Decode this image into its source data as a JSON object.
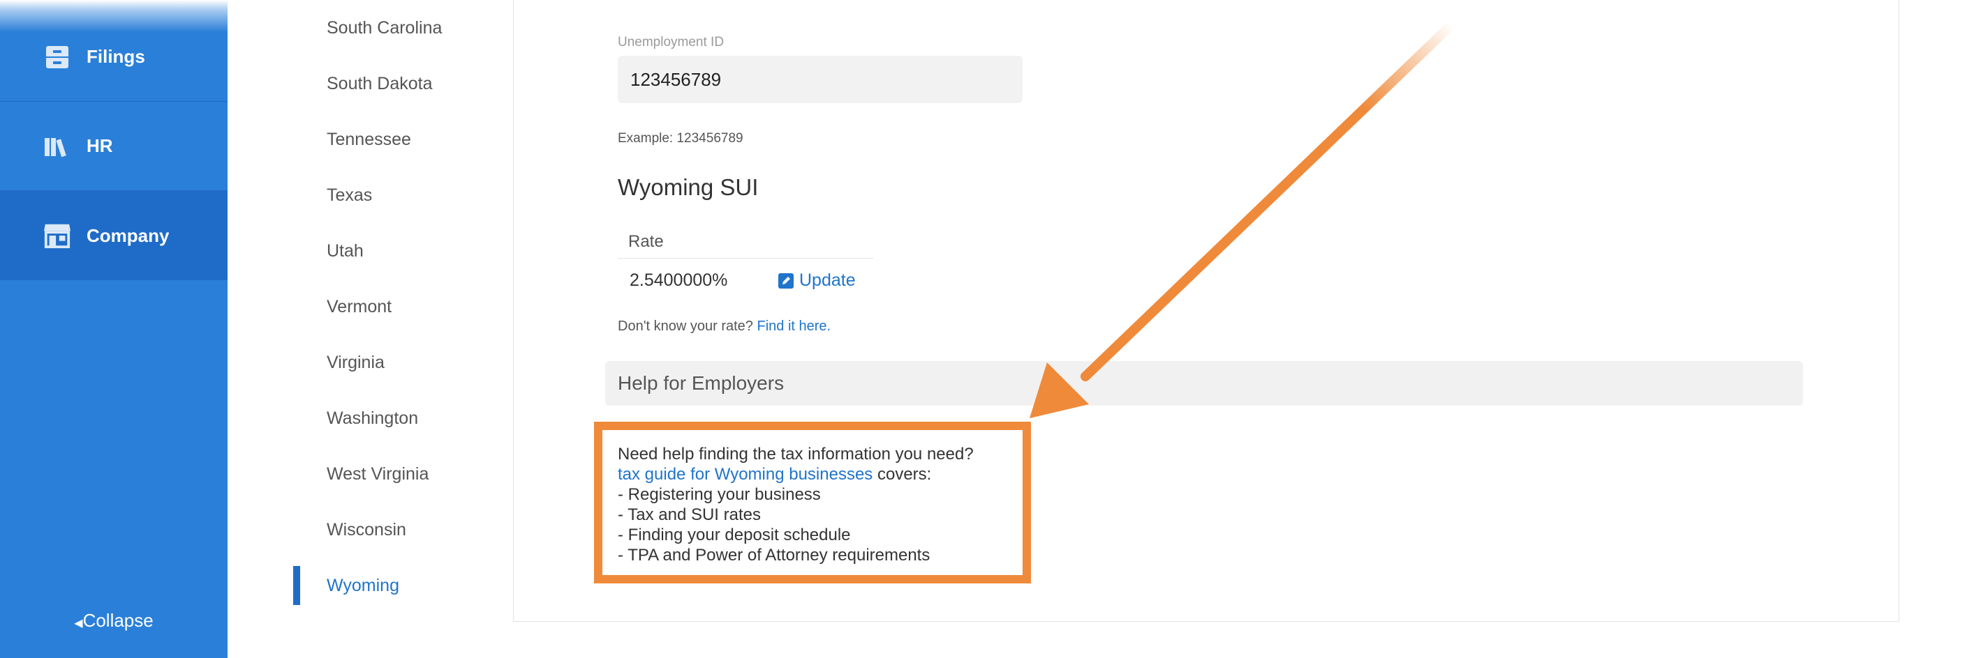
{
  "sidebar": {
    "items": [
      {
        "label": "Filings",
        "icon": "filing-cabinet-icon"
      },
      {
        "label": "HR",
        "icon": "books-icon"
      },
      {
        "label": "Company",
        "icon": "storefront-icon",
        "active": true
      }
    ],
    "collapse_label": "Collapse"
  },
  "states": [
    "South Carolina",
    "South Dakota",
    "Tennessee",
    "Texas",
    "Utah",
    "Vermont",
    "Virginia",
    "Washington",
    "West Virginia",
    "Wisconsin",
    "Wyoming"
  ],
  "active_state": "Wyoming",
  "form": {
    "unemployment_label": "Unemployment ID",
    "unemployment_value": "123456789",
    "example": "Example: 123456789",
    "sui_title": "Wyoming SUI",
    "rate_header": "Rate",
    "rate_value": "2.5400000%",
    "update_label": "Update",
    "dont_know_text": "Don't know your rate?",
    "find_link": "Find it here."
  },
  "help": {
    "title": "Help for Employers",
    "intro": "Need help finding the tax information you need?",
    "guide_link": "tax guide for Wyoming businesses",
    "guide_suffix": " covers:",
    "bullets": [
      "- Registering your business",
      "- Tax and SUI rates",
      "- Finding your deposit schedule",
      "- TPA and Power of Attorney requirements"
    ]
  },
  "colors": {
    "sidebar": "#2a7fd9",
    "accent": "#1f74cc",
    "highlight": "#ef8a3a"
  }
}
